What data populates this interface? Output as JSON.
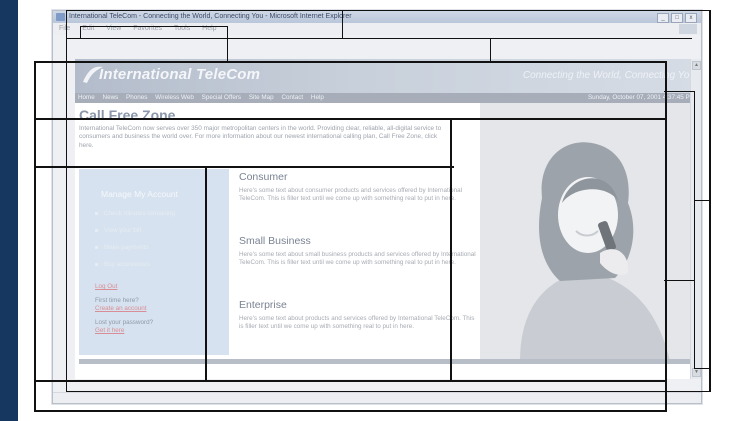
{
  "browser": {
    "title": "International TeleCom - Connecting the World, Connecting You - Microsoft Internet Explorer",
    "menu": [
      "File",
      "Edit",
      "View",
      "Favorites",
      "Tools",
      "Help"
    ],
    "window_buttons": [
      "_",
      "□",
      "x"
    ]
  },
  "site": {
    "logo": "International TeleCom",
    "tagline": "Connecting the World, Connecting You",
    "nav": [
      "Home",
      "News",
      "Phones",
      "Wireless Web",
      "Special Offers",
      "Site Map",
      "Contact",
      "Help"
    ],
    "date": "Sunday, October 07, 2001 4:37:45 PM"
  },
  "main": {
    "heading": "Call Free Zone",
    "intro": "International TeleCom now serves over 350 major metropolitan centers in the world. Providing clear, reliable, all-digital service to consumers and business the world over. For more information about our newest international calling plan, Call Free Zone, click here."
  },
  "sidebar": {
    "title": "Manage My Account",
    "items": [
      "Check minutes remaining",
      "View your bill",
      "Make payments",
      "Buy accessories"
    ],
    "logout": "Log Out",
    "first_time": "First time here?",
    "create_account": "Create an account",
    "lost_password": "Lost your password?",
    "get_it_here": "Get it here"
  },
  "sections": [
    {
      "title": "Consumer",
      "body": "Here's some text about consumer products and services offered by International TeleCom. This is filler text until we come up with something real to put in here."
    },
    {
      "title": "Small Business",
      "body": "Here's some text about small business products and services offered by International TeleCom. This is filler text until we come up with something real to put in here."
    },
    {
      "title": "Enterprise",
      "body": "Here's some text about products and services offered by International TeleCom. This is filler text until we come up with something real to put in here."
    }
  ],
  "colors": {
    "left_band": "#16375f",
    "header_gradient_start": "#b3bccb",
    "nav_bar": "#a7aeba",
    "sidebar_bg": "#d6e2ef",
    "heading": "#8a97ac",
    "overlay_stroke": "#111111"
  }
}
